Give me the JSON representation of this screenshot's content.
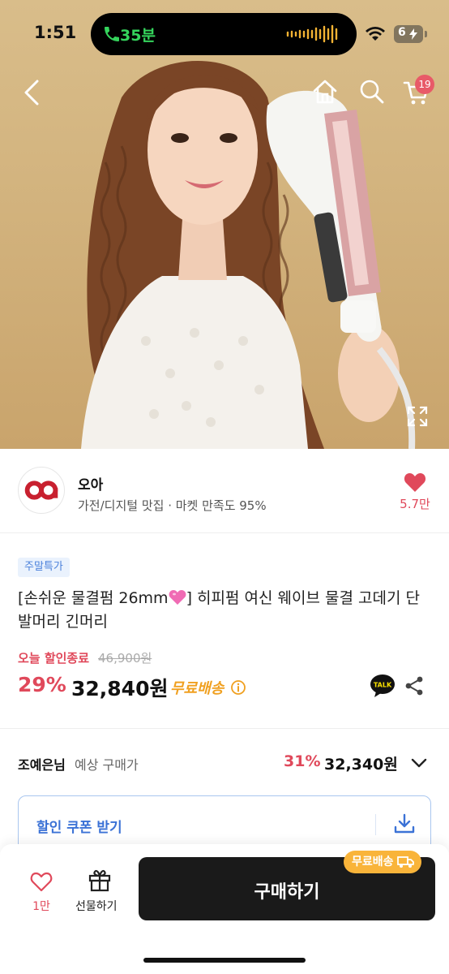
{
  "status_bar": {
    "time": "1:51",
    "call_duration": "35분",
    "battery": "6"
  },
  "hero": {
    "cart_count": "19"
  },
  "seller": {
    "name": "오아",
    "description": "가전/디지털 맛집 · 마켓 만족도 95%",
    "likes": "5.7만"
  },
  "product": {
    "tag": "주말특가",
    "title_part1": "[손쉬운 물결펌 26mm",
    "title_part2": "] 히피펌 여신 웨이브 물결 고데기 단발머리 긴머리",
    "sale_end": "오늘 할인종료",
    "original_price": "46,900원",
    "discount": "29%",
    "price": "32,840원",
    "free_shipping": "무료배송"
  },
  "member_price": {
    "name": "조예은님",
    "label": "예상 구매가",
    "discount": "31%",
    "price": "32,340원"
  },
  "coupon": {
    "label": "할인 쿠폰 받기"
  },
  "bottom_bar": {
    "wish_count": "1만",
    "gift_label": "선물하기",
    "buy_label": "구매하기",
    "ship_badge": "무료배송"
  },
  "colors": {
    "accent_red": "#e0495b",
    "shipping_orange": "#f0a020",
    "coupon_blue": "#3b72d6",
    "buy_button": "#1a1a1a"
  }
}
